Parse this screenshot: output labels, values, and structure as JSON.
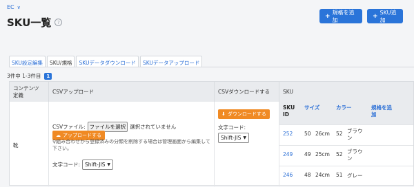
{
  "header": {
    "breadcrumb": "EC",
    "title": "SKU一覧",
    "add_spec_label": "規格を追加",
    "add_sku_label": "SKU追加"
  },
  "tabs": [
    "SKU設定編集",
    "SKU/規格",
    "SKUデータダウンロード",
    "SKUデータアップロード"
  ],
  "active_tab": 1,
  "count_text": "3件中 1-3件目",
  "page_number": "1",
  "table": {
    "headers": {
      "content": "コンテンツ\n定義",
      "csv_upload": "CSVアップロード",
      "csv_download": "CSVダウンロードする",
      "sku": "SKU"
    },
    "row_label": "靴",
    "csv_file_label": "CSVファイル:",
    "file_button": "ファイルを選択",
    "no_file_text": "選択されていません",
    "upload_button": "アップロードする",
    "warning": "組み合わせから登録済みの分類を削除する場合は管理画面から編集して下さい。",
    "encoding_label": "文字コード:",
    "encoding_value": "Shift-JIS",
    "download_button": "ダウンロードする",
    "sku_headers": {
      "id": "SKU\nID",
      "size": "サイズ",
      "color": "カラー",
      "add_spec": "規格を追\n加"
    },
    "sku_rows": [
      {
        "id": "252",
        "size_code": "50",
        "size": "26cm",
        "color_code": "52",
        "color": "ブラウ\nン"
      },
      {
        "id": "249",
        "size_code": "49",
        "size": "25cm",
        "color_code": "52",
        "color": "ブラウ\nン"
      },
      {
        "id": "246",
        "size_code": "48",
        "size": "24cm",
        "color_code": "51",
        "color": "グレー"
      }
    ]
  }
}
